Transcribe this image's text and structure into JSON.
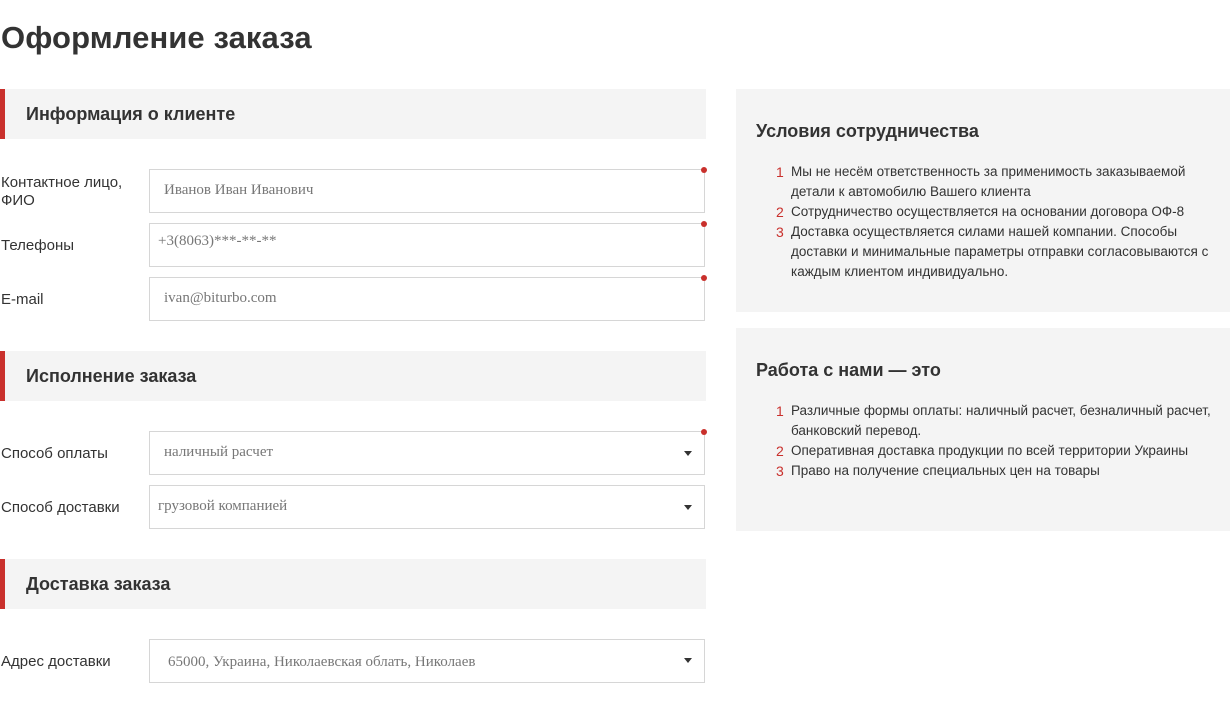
{
  "page": {
    "title": "Оформление заказа"
  },
  "colors": {
    "accent": "#c9302c",
    "section_bg": "#f4f4f4"
  },
  "client_info": {
    "header": "Информация о клиенте",
    "fields": [
      {
        "label": "Контактное лицо, ФИО",
        "value": "Иванов Иван Иванович",
        "required": true
      },
      {
        "label": "Телефоны",
        "value": "+3(8063)***-**-**",
        "required": true
      },
      {
        "label": "E-mail",
        "value": "ivan@biturbo.com",
        "required": true
      }
    ]
  },
  "order_execution": {
    "header": "Исполнение заказа",
    "fields": [
      {
        "label": "Способ оплаты",
        "value": "наличный расчет",
        "required": true,
        "type": "select"
      },
      {
        "label": "Способ доставки",
        "value": "грузовой компанией",
        "required": false,
        "type": "select"
      }
    ]
  },
  "order_delivery": {
    "header": "Доставка заказа",
    "fields": [
      {
        "label": "Адрес доставки",
        "value": "65000, Украина, Николаевская облать, Николаев",
        "type": "select"
      }
    ]
  },
  "terms": {
    "title": "Условия сотрудничества",
    "items": [
      {
        "num": "1",
        "text": "Мы не несём ответственность за применимость заказываемой детали к автомобилю Вашего клиента"
      },
      {
        "num": "2",
        "text": "Сотрудничество осуществляется на основании договора ОФ-8"
      },
      {
        "num": "3",
        "text": "Доставка осуществляется силами нашей компании. Способы доставки и минимальные параметры отправки согласовываются с каждым клиентом индивидуально."
      }
    ]
  },
  "benefits": {
    "title": "Работа с нами — это",
    "items": [
      {
        "num": "1",
        "text": "Различные формы оплаты: наличный расчет, безналичный расчет, банковский перевод."
      },
      {
        "num": "2",
        "text": "Оперативная доставка продукции по всей территории Украины"
      },
      {
        "num": "3",
        "text": "Право на получение специальных цен на товары"
      }
    ]
  }
}
